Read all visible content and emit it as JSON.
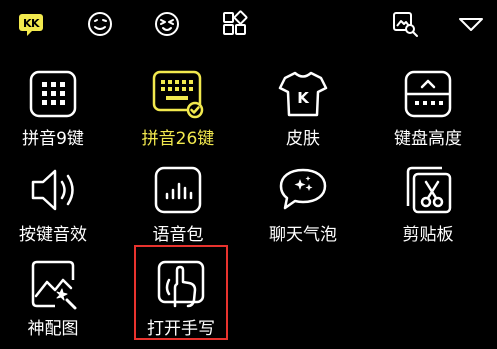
{
  "colors": {
    "accent": "#f2e94e",
    "icon": "#ffffff",
    "highlight_border": "#e8332e",
    "background": "#000000"
  },
  "toolbar": {
    "icons": [
      "kk-keyboard-logo-icon",
      "emoji-smile-icon",
      "emoticon-icon",
      "apps-grid-icon",
      "image-search-icon",
      "collapse-triangle-icon"
    ],
    "logo_letters": "K K"
  },
  "grid": {
    "items": [
      {
        "label": "拼音9键",
        "icon": "nine-key-icon"
      },
      {
        "label": "拼音26键",
        "icon": "full-keyboard-icon",
        "selected": true
      },
      {
        "label": "皮肤",
        "icon": "tshirt-skin-icon",
        "shirt_letter": "K"
      },
      {
        "label": "键盘高度",
        "icon": "keyboard-height-icon"
      },
      {
        "label": "按键音效",
        "icon": "speaker-icon"
      },
      {
        "label": "语音包",
        "icon": "voice-pack-icon"
      },
      {
        "label": "聊天气泡",
        "icon": "chat-bubble-icon"
      },
      {
        "label": "剪贴板",
        "icon": "clipboard-scissors-icon"
      },
      {
        "label": "神配图",
        "icon": "magic-image-icon"
      },
      {
        "label": "打开手写",
        "icon": "handwriting-icon",
        "highlighted": true
      }
    ]
  }
}
